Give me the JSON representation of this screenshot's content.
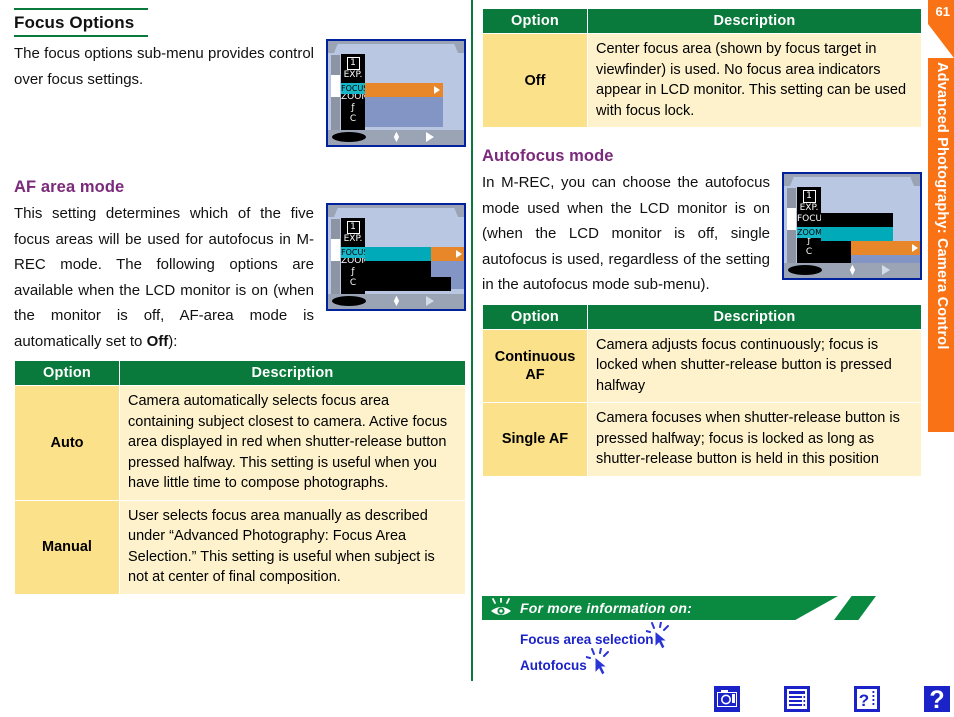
{
  "page": {
    "number": "61",
    "section_title": "Advanced Photography: Camera Control"
  },
  "left_column": {
    "focus_options": {
      "heading": "Focus Options",
      "body": "The focus options sub-menu provides control over focus settings."
    },
    "af_area_mode": {
      "heading": "AF area mode",
      "body_part1": "This setting determines which of the five focus areas will be used for autofocus in M-REC mode. The following options are available when the LCD monitor is on (when the monitor is off, AF-area mode is automatically set to ",
      "body_bold": "Off",
      "body_part2": "):"
    },
    "table": {
      "headers": [
        "Option",
        "Description"
      ],
      "rows": [
        {
          "option": "Auto",
          "description": "Camera automatically selects focus area containing subject closest to camera. Active focus area displayed in red when shutter-release button pressed halfway. This setting is useful when you have little time to compose photographs."
        },
        {
          "option": "Manual",
          "description": "User selects focus area manually as described under “Advanced Photography: Focus Area Selection.”  This setting is useful when subject is not at center of final composition."
        }
      ]
    }
  },
  "right_column": {
    "off_table": {
      "headers": [
        "Option",
        "Description"
      ],
      "rows": [
        {
          "option": "Off",
          "description": "Center focus area (shown by focus target in viewfinder) is used.  No focus area indicators appear in LCD monitor. This setting can be used with focus lock."
        }
      ]
    },
    "autofocus_mode": {
      "heading": "Autofocus mode",
      "body": "In M-REC, you can choose the autofocus mode used when the LCD monitor is on (when the LCD monitor is off, single autofocus is used, regardless of the setting in the autofocus mode sub-menu)."
    },
    "af_table": {
      "headers": [
        "Option",
        "Description"
      ],
      "rows": [
        {
          "option": "Continuous AF",
          "description": "Camera adjusts focus continuously; focus is locked when shutter-release button is pressed halfway"
        },
        {
          "option": "Single AF",
          "description": "Camera focuses when shutter-release button is pressed halfway; focus is locked as long as shutter-release button is held in this position"
        }
      ]
    },
    "more_info": {
      "title": "For more information on:",
      "links": [
        {
          "label": "Focus area selection"
        },
        {
          "label": "Autofocus"
        }
      ]
    }
  },
  "lcd_screens": {
    "menu_labels": [
      "1",
      "EXP.",
      "FOCUS",
      "ZOOM",
      "ƒ",
      "C"
    ],
    "screen1_selected": "FOCUS",
    "screen2_selected": "FOCUS",
    "screen3_selected": "ZOOM"
  },
  "bottom_nav": {
    "icons": [
      {
        "name": "camera-icon",
        "glyph": "◎"
      },
      {
        "name": "menu-list-icon",
        "glyph": "≡"
      },
      {
        "name": "help-index-icon",
        "glyph": "?"
      },
      {
        "name": "question-mark-icon",
        "glyph": "?"
      }
    ]
  },
  "colors": {
    "table_header_green": "#0a7a3c",
    "option_cell_yellow": "#fbe189",
    "description_cell_cream": "#fdf2cc",
    "heading_purple": "#7b2a7b",
    "side_tab_orange": "#f97316",
    "link_blue": "#1b23c8",
    "banner_green": "#0a8a40"
  }
}
